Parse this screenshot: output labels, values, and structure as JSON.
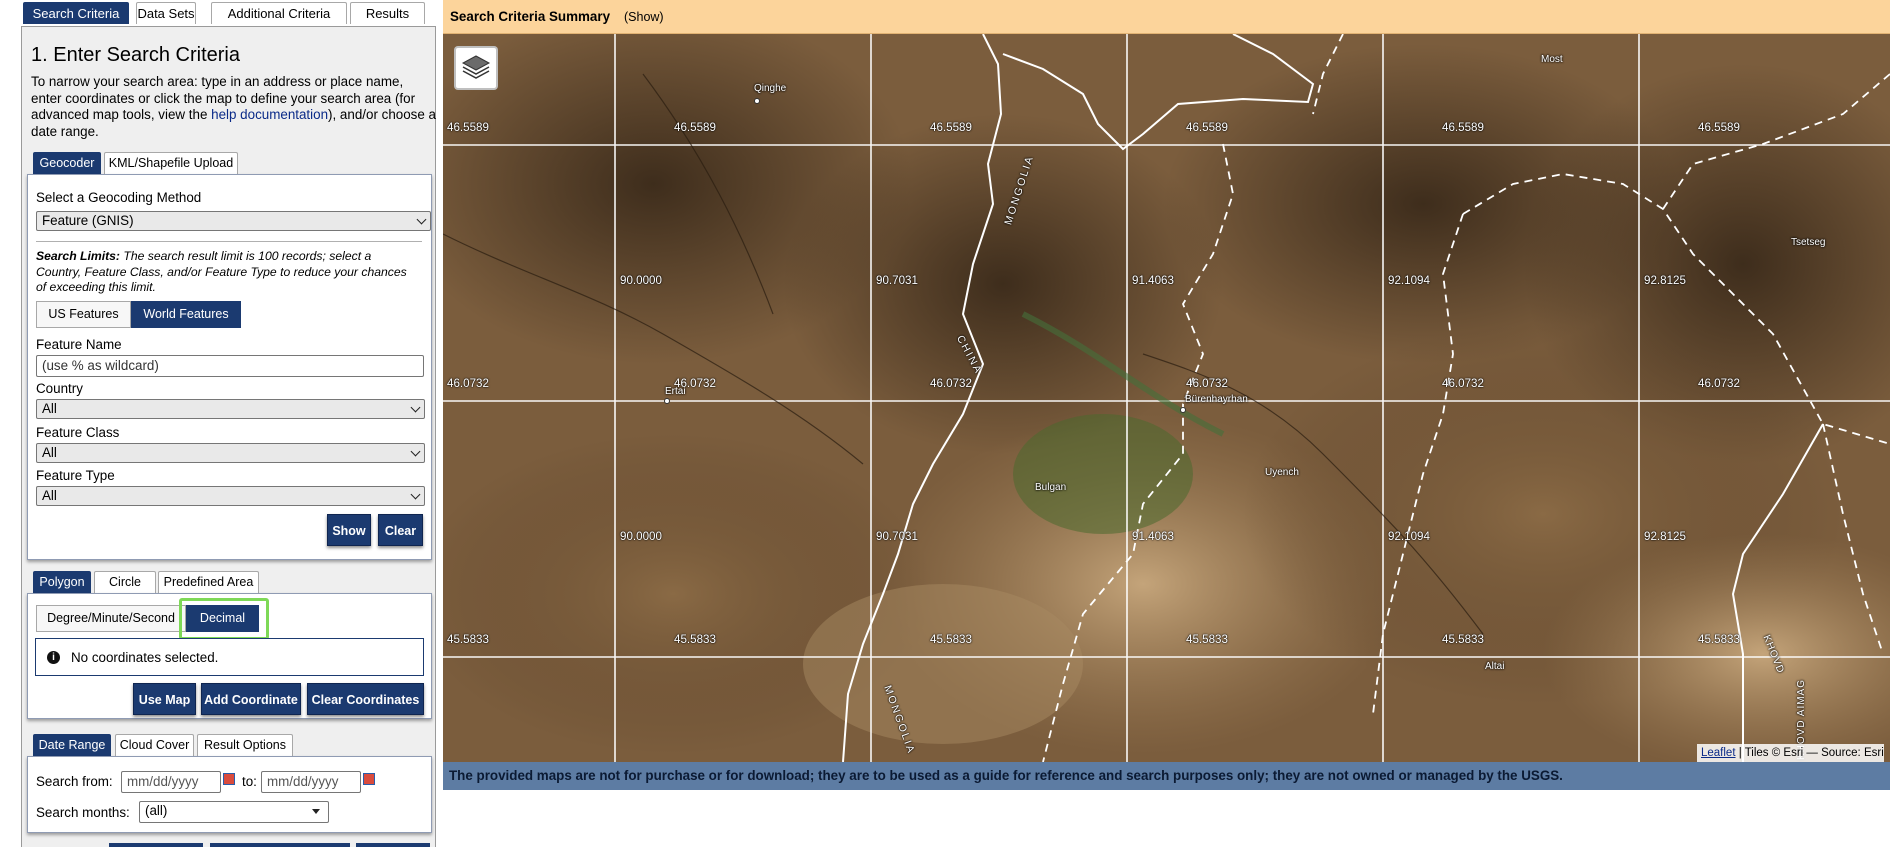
{
  "main_tabs": [
    "Search Criteria",
    "Data Sets",
    "Additional Criteria",
    "Results"
  ],
  "heading": "1. Enter Search Criteria",
  "intro": {
    "before": "To narrow your search area: type in an address or place name, enter coordinates or click the map to define your search area (for advanced map tools, view the ",
    "link": "help documentation",
    "after": "), and/or choose a date range."
  },
  "geocoder_tabs": [
    "Geocoder",
    "KML/Shapefile Upload"
  ],
  "geocoding": {
    "method_label": "Select a Geocoding Method",
    "method_value": "Feature (GNIS)",
    "limits_bold": "Search Limits:",
    "limits_text": " The search result limit is 100 records; select a Country, Feature Class, and/or Feature Type to reduce your chances of exceeding this limit.",
    "us_features": "US Features",
    "world_features": "World Features",
    "feature_name_label": "Feature Name",
    "feature_name_placeholder": "(use % as wildcard)",
    "country_label": "Country",
    "country_value": "All",
    "class_label": "Feature Class",
    "class_value": "All",
    "type_label": "Feature Type",
    "type_value": "All",
    "show_button": "Show",
    "clear_button": "Clear"
  },
  "area_tabs": [
    "Polygon",
    "Circle",
    "Predefined Area"
  ],
  "coords": {
    "dms": "Degree/Minute/Second",
    "decimal": "Decimal",
    "no_coords": "No coordinates selected.",
    "use_map": "Use Map",
    "add_coordinate": "Add Coordinate",
    "clear_coordinates": "Clear Coordinates"
  },
  "date_tabs": [
    "Date Range",
    "Cloud Cover",
    "Result Options"
  ],
  "date": {
    "from_label": "Search from:",
    "from_placeholder": "mm/dd/yyyy",
    "to_label": "to:",
    "to_placeholder": "mm/dd/yyyy",
    "months_label": "Search months:",
    "months_value": "(all)"
  },
  "summary": {
    "title": "Search Criteria Summary",
    "show": "(Show)"
  },
  "map": {
    "lat_labels": [
      "46.5589",
      "46.0732",
      "45.5833"
    ],
    "lon_labels": [
      "90.0000",
      "90.7031",
      "91.4063",
      "92.1094",
      "92.8125"
    ],
    "places": [
      "Qinghe",
      "Most",
      "Tsetseg",
      "Ertai",
      "Bürenhayrhan",
      "Bulgan",
      "Uyench",
      "Altai"
    ],
    "border_labels": [
      "MONGOLIA",
      "CHINA",
      "MONGOLIA",
      "KHOVD",
      "KHOVD AIMAG"
    ],
    "attribution_link": "Leaflet",
    "attribution_text": " | Tiles © Esri — Source: Esri"
  },
  "disclaimer": "The provided maps are not for purchase or for download; they are to be used as a guide for reference and search purposes only; they are not owned or managed by the USGS.",
  "colors": {
    "navy": "#1b3a70",
    "summary_bar": "#fcd49b",
    "disclaimer_bar": "#5d7ca3",
    "highlight": "#7ed957"
  }
}
